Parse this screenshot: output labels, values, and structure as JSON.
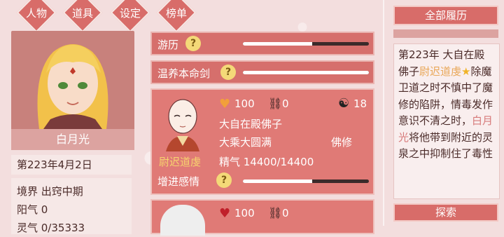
{
  "tabs": [
    {
      "label": "人物"
    },
    {
      "label": "道具"
    },
    {
      "label": "设定"
    },
    {
      "label": "榜单"
    }
  ],
  "character": {
    "name": "白月光",
    "date": "第223年4月2日",
    "realm": "境界 出窍中期",
    "yang": "阳气 0",
    "ling": "灵气 0/35333"
  },
  "rows": [
    {
      "label": "游历",
      "help": "?",
      "progress": 0.55
    },
    {
      "label": "温养本命剑",
      "help": "?",
      "progress": 1.0
    }
  ],
  "npc": {
    "affection": "100",
    "chains": "0",
    "yinyang": "18",
    "title": "大自在殿佛子",
    "realm": "大乘大圆满",
    "path": "佛修",
    "name": "尉迟道虔",
    "jingqi": "精气 14400/14400",
    "action": "增进感情",
    "help": "?",
    "progress": 0.55
  },
  "npc2": {
    "affection": "100",
    "chains": "0"
  },
  "history": {
    "header": "全部履历",
    "p1": "第223年 大自在殿佛子",
    "name1": "尉迟道虔",
    "star": "★",
    "p2": "除魔卫道之时不慎中了魔修的陷阱，情毒发作意识不清之时，",
    "name2": "白月光",
    "p3": "将他带到附近的灵泉之中抑制住了毒性",
    "explore": "探索"
  },
  "colors": {
    "accent": "#d86c69",
    "gold": "#f6d36e",
    "help": "#f4d978"
  }
}
